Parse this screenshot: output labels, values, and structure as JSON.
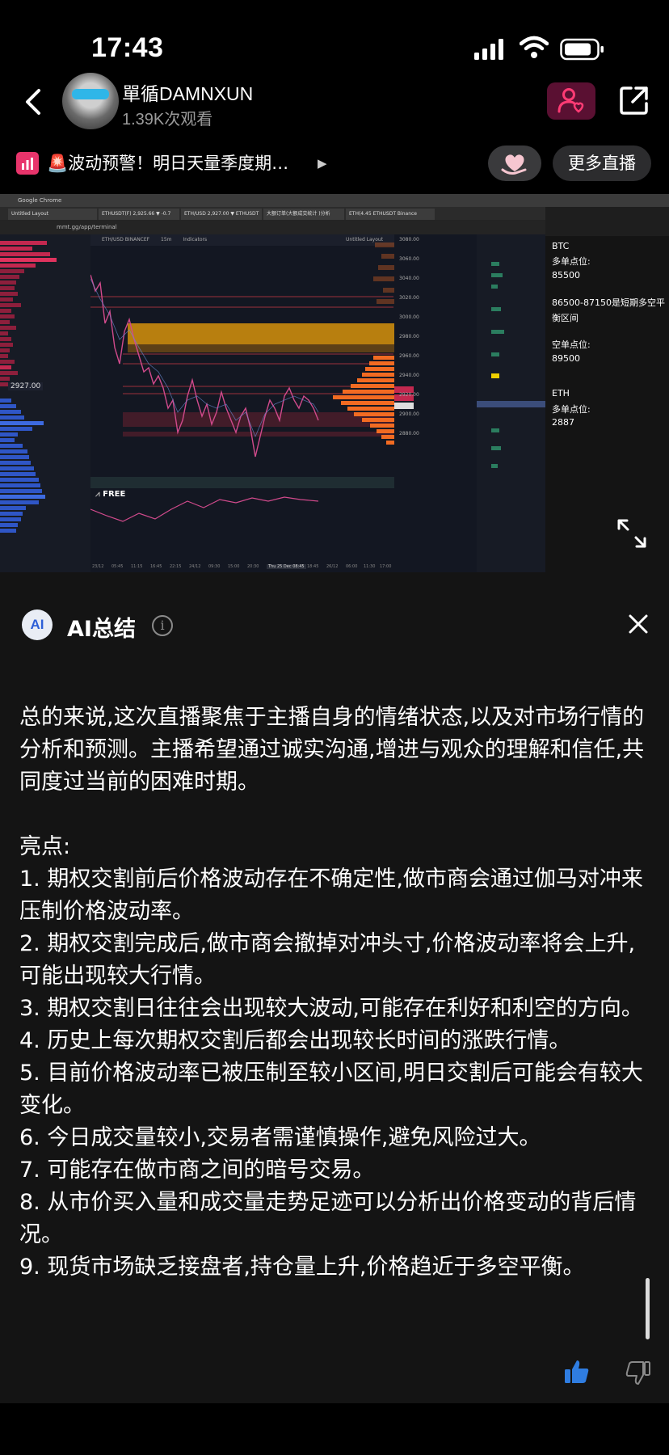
{
  "status_bar": {
    "time": "17:43"
  },
  "header": {
    "streamer_name": "單循DAMNXUN",
    "views": "1.39K次观看"
  },
  "ticker": {
    "text": "🚨波动预警！明日天量季度期…",
    "more_live_label": "更多直播"
  },
  "stream": {
    "browser_title": "Google Chrome",
    "url": "mmt.gg/app/terminal",
    "tabs": [
      "Untitled Layout",
      "ETHUSDT(F) 2,925.66 ▼ -0.7",
      "ETH/USD 2,927.00 ▼ ETHUSDT",
      "大额订单(大额成交统计 )分析",
      "ETH(4.45 ETHUSDT Binance"
    ],
    "chart_symbol": "ETH/USD BINANCEF",
    "timeframe": "15m",
    "indicators_label": "Indicators",
    "layout_label": "Untitled Layout",
    "current_price_box": "2927.00",
    "free_tag": "FREE",
    "notes": [
      "BTC",
      "多单点位:",
      "85500",
      "86500-87150是短期多空平",
      "衡区间",
      "空单点位:",
      "89500",
      "ETH",
      "多单点位:",
      "2887"
    ],
    "price_axis": [
      "3080.00",
      "3060.00",
      "3040.00",
      "3020.00",
      "3000.00",
      "2980.00",
      "2960.00",
      "2940.00",
      "2920.00",
      "2900.00",
      "2880.00"
    ],
    "time_axis": [
      "23/12",
      "05:45",
      "11:15",
      "16:45",
      "22:15",
      "24/12",
      "09:30",
      "15:00",
      "20:30",
      "Thu 25 Dec 08:45",
      "18:45",
      "26/12",
      "06:00",
      "11:30",
      "17:00"
    ]
  },
  "ai_summary": {
    "badge": "AI",
    "title": "AI总结",
    "intro": "总的来说,这次直播聚焦于主播自身的情绪状态,以及对市场行情的分析和预测。主播希望通过诚实沟通,增进与观众的理解和信任,共同度过当前的困难时期。",
    "highlights_heading": "亮点:",
    "highlights": [
      "1. 期权交割前后价格波动存在不确定性,做市商会通过伽马对冲来压制价格波动率。",
      "2. 期权交割完成后,做市商会撤掉对冲头寸,价格波动率将会上升,可能出现较大行情。",
      "3. 期权交割日往往会出现较大波动,可能存在利好和利空的方向。",
      "4. 历史上每次期权交割后都会出现较长时间的涨跌行情。",
      "5. 目前价格波动率已被压制至较小区间,明日交割后可能会有较大变化。",
      "6. 今日成交量较小,交易者需谨慎操作,避免风险过大。",
      "7. 可能存在做市商之间的暗号交易。",
      "8. 从市价买入量和成交量走势足迹可以分析出价格变动的背后情况。",
      "9. 现货市场缺乏接盘者,持仓量上升,价格趋近于多空平衡。"
    ]
  },
  "colors": {
    "accent_blue": "#2f7de1",
    "follow_bg": "#5a1032",
    "follow_icon": "#ff3b74",
    "bid": "#2f56c6",
    "ask": "#c3284f",
    "zone_orange": "#f0a30a",
    "profile_orange": "#f26b22"
  }
}
